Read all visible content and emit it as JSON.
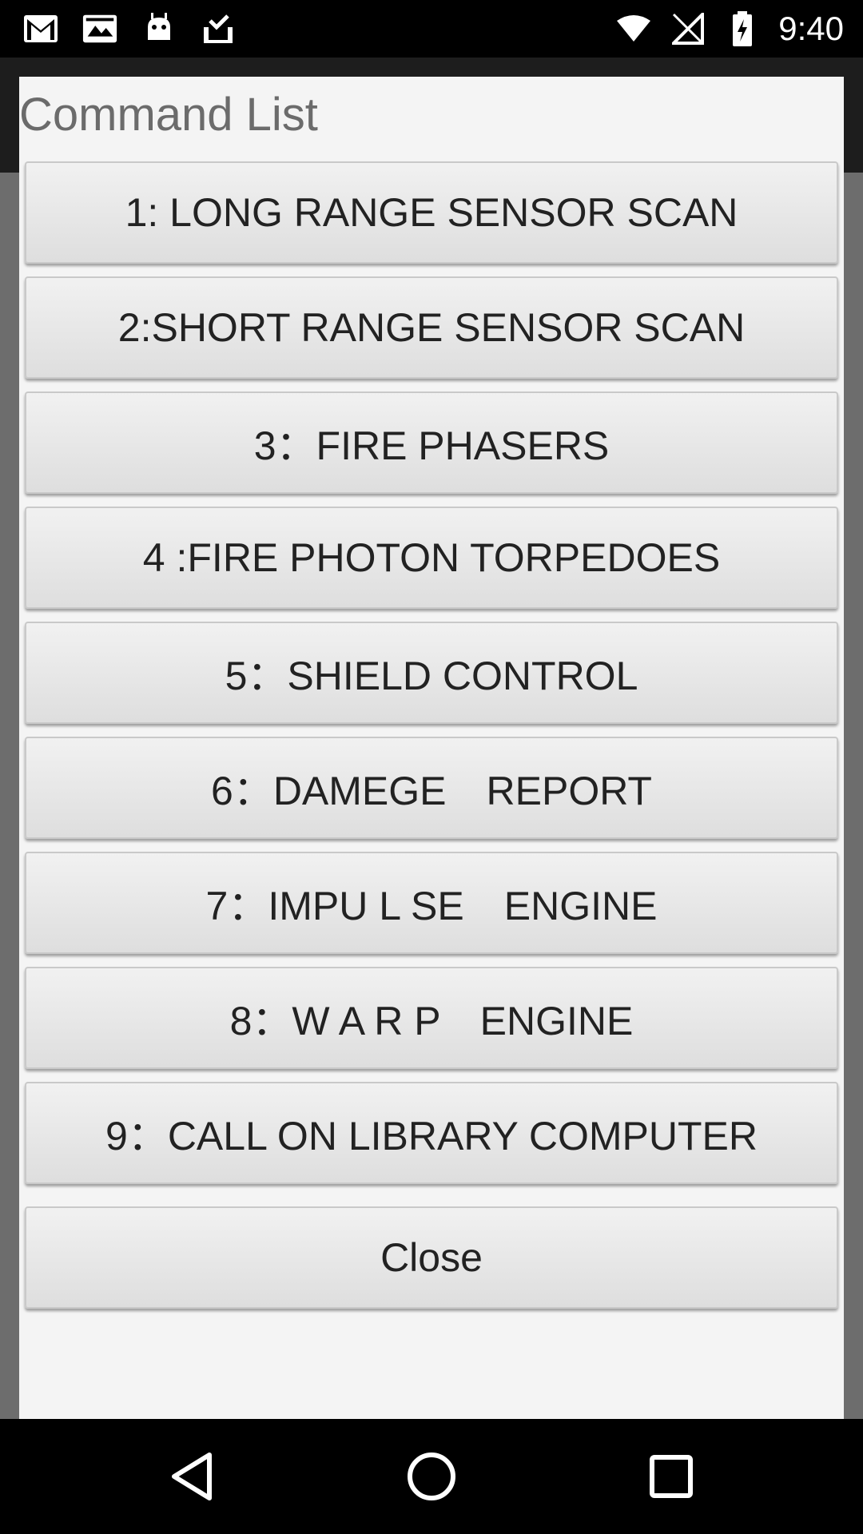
{
  "status_bar": {
    "icons_left": [
      "gmail-icon",
      "gallery-icon",
      "android-icon",
      "clipboard-check-icon"
    ],
    "icons_right": [
      "wifi-icon",
      "signal-icon",
      "battery-icon"
    ],
    "time": "9:40"
  },
  "dialog": {
    "title": "Command List",
    "commands": [
      "1: LONG RANGE SENSOR SCAN",
      "2:SHORT RANGE SENSOR SCAN",
      "3：FIRE PHASERS",
      "4 :FIRE PHOTON TORPEDOES",
      "5：SHIELD CONTROL",
      "6：DAMEGE　REPORT",
      "7：IMPU L SE　ENGINE",
      "8：W A R P　ENGINE",
      "9：CALL ON LIBRARY COMPUTER"
    ],
    "close_label": "Close"
  },
  "nav_bar": {
    "buttons": [
      "back-icon",
      "home-icon",
      "recents-icon"
    ]
  }
}
